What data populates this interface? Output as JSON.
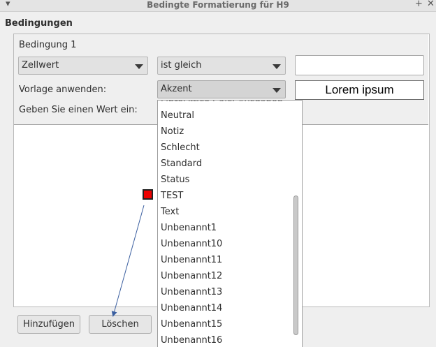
{
  "window": {
    "title": "Bedingte Formatierung für H9",
    "menu_glyph": "▾",
    "max_glyph": "+",
    "close_glyph": "✕"
  },
  "section": {
    "label": "Bedingungen"
  },
  "condition": {
    "heading": "Bedingung 1",
    "type_combo": "Zellwert",
    "operator_combo": "ist gleich",
    "value_field": "",
    "style_label": "Vorlage anwenden:",
    "style_combo": "Akzent",
    "preview_text": "Lorem ipsum",
    "enter_value_label": "Geben Sie einen Wert ein:"
  },
  "style_dropdown": {
    "partial_item": "LibreOffice Calc: Ausgaben",
    "items": [
      "Neutral",
      "Notiz",
      "Schlecht",
      "Standard",
      "Status",
      "TEST",
      "Text",
      "Unbenannt1",
      "Unbenannt10",
      "Unbenannt11",
      "Unbenannt12",
      "Unbenannt13",
      "Unbenannt14",
      "Unbenannt15",
      "Unbenannt16"
    ]
  },
  "buttons": {
    "add": "Hinzufügen",
    "delete": "Löschen"
  },
  "colors": {
    "annotation_marker": "#ee0000",
    "annotation_arrow": "#3b5fa0"
  }
}
